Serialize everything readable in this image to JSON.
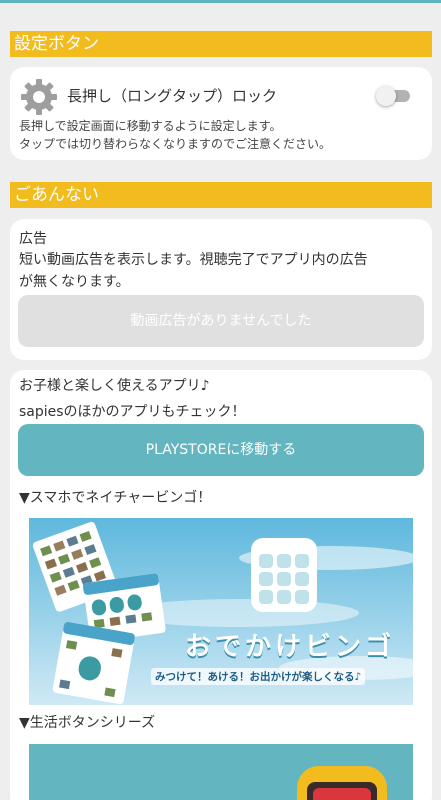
{
  "settings_section": {
    "header": "設定ボタン",
    "lock_title": "長押し（ロングタップ）ロック",
    "lock_enabled": false,
    "desc_line1": "長押しで設定画面に移動するように設定します。",
    "desc_line2": "タップでは切り替わらなくなりますのでご注意ください。"
  },
  "info_section": {
    "header": "ごあんない",
    "ad_title": "広告",
    "ad_desc_line1": "短い動画広告を表示します。視聴完了でアプリ内の広告",
    "ad_desc_line2": "が無くなります。",
    "ad_button_label": "動画広告がありませんでした"
  },
  "apps_section": {
    "intro_line1": "お子様と楽しく使えるアプリ♪",
    "intro_line2": "sapiesのほかのアプリもチェック！",
    "playstore_button_label": "PLAYSTOREに移動する",
    "app1_label": "▼スマホでネイチャービンゴ！",
    "app1_banner_title": "おでかけビンゴ",
    "app1_banner_subtitle": "みつけて！あける！お出かけが楽しくなる♪",
    "app2_label": "▼生活ボタンシリーズ"
  },
  "colors": {
    "accent_yellow": "#f2bc1f",
    "teal": "#63b6bf",
    "background": "#eeeeee"
  },
  "icons": {
    "settings": "gear-icon",
    "bingo_grid": "grid-icon"
  }
}
